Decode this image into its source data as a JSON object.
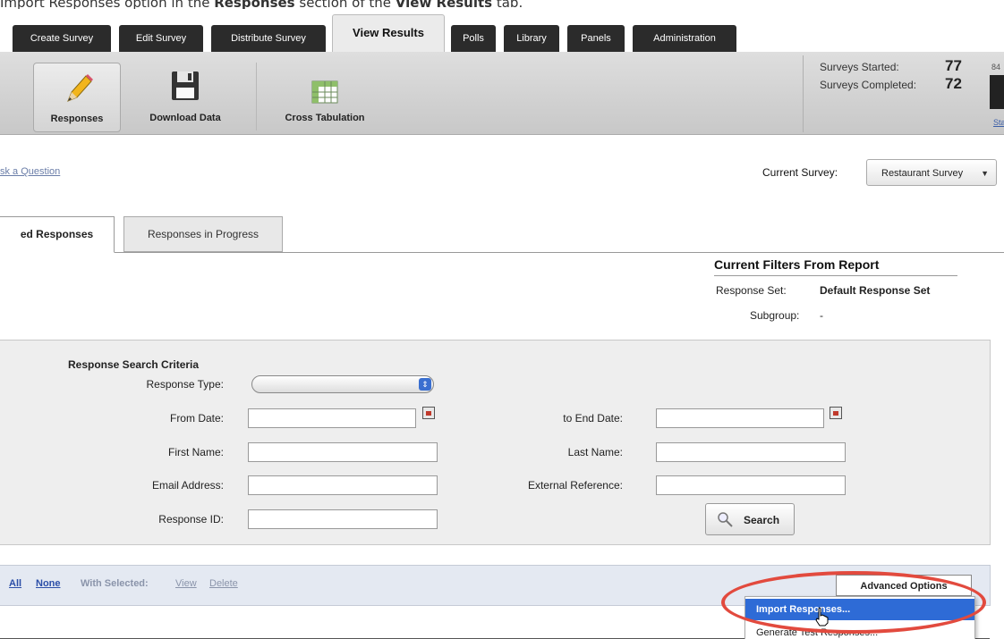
{
  "caption": {
    "prefix": "Import Responses option in the ",
    "bold1": "Responses",
    "middle": " section of the ",
    "bold2": "View Results",
    "suffix": " tab."
  },
  "main_tabs": [
    "Create Survey",
    "Edit Survey",
    "Distribute Survey",
    "View Results",
    "Polls",
    "Library",
    "Panels",
    "Administration"
  ],
  "toolbar": {
    "responses": "Responses",
    "download": "Download Data",
    "cross_tab": "Cross Tabulation"
  },
  "stats": {
    "started_label": "Surveys Started:",
    "started_value": "77",
    "completed_label": "Surveys Completed:",
    "completed_value": "72",
    "pct": "84",
    "link": "Stat"
  },
  "ask_link": "sk a Question",
  "current_survey": {
    "label": "Current Survey:",
    "value": "Restaurant Survey"
  },
  "subtabs": {
    "active": "ed Responses",
    "inactive": "Responses in Progress"
  },
  "filters": {
    "title": "Current Filters From Report",
    "response_set_label": "Response Set:",
    "response_set_value": "Default Response Set",
    "subgroup_label": "Subgroup:",
    "subgroup_value": "-"
  },
  "search_criteria": {
    "title": "Response Search Criteria",
    "response_type": "Response Type:",
    "from_date": "From Date:",
    "to_end_date": "to End Date:",
    "first_name": "First Name:",
    "last_name": "Last Name:",
    "email": "Email Address:",
    "external_ref": "External Reference:",
    "response_id": "Response ID:",
    "search_button": "Search"
  },
  "bottom_bar": {
    "all": "All",
    "none": "None",
    "with_selected": "With Selected:",
    "view": "View",
    "delete": "Delete",
    "advanced": "Advanced Options"
  },
  "dropdown": {
    "import": "Import Responses...",
    "generate": "Generate Test Responses..."
  },
  "colors": {
    "highlight": "#2e6bd6",
    "annotation": "#e24a3e",
    "tab_dark": "#2b2b2b"
  }
}
